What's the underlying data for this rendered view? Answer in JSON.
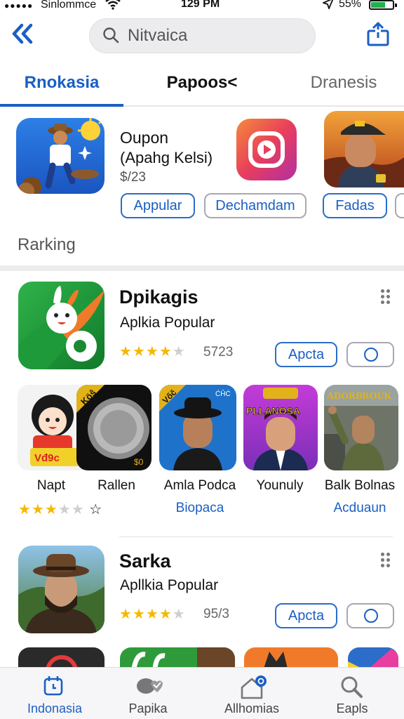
{
  "status_bar": {
    "signal": "●●●●●",
    "carrier": "Sinlommce",
    "time": "129 PM",
    "battery_pct": "55%",
    "battery_level": 0.55
  },
  "header": {
    "search_placeholder": "Nitvaica",
    "back_icon": "double-chevron-left-icon",
    "share_icon": "share-icon"
  },
  "tabs": [
    {
      "label": "Rnokasia",
      "active": true
    },
    {
      "label": "Papoos<",
      "active": false
    },
    {
      "label": "Dranesis",
      "active": false
    }
  ],
  "featured": {
    "title": "Oupon",
    "subtitle": "(Apahg Kelsi)",
    "price": "$/23",
    "buttons": [
      "Appular",
      "Dechamdam",
      "Fadas"
    ]
  },
  "section_label": "Rarking",
  "apps": [
    {
      "title": "Dpikagis",
      "subtitle": "Aplkia Popular",
      "rating": 4,
      "rating_count": "5723",
      "action": "Apcta"
    },
    {
      "title": "Sarka",
      "subtitle": "Apllkia Popular",
      "rating": 4,
      "rating_count": "95/3",
      "action": "Apcta"
    }
  ],
  "grid": [
    {
      "label": "Napt",
      "link": ""
    },
    {
      "label": "Rallen",
      "link": ""
    },
    {
      "label": "Amla Podca",
      "link": "Biopaca"
    },
    {
      "label": "Younuly",
      "link": ""
    },
    {
      "label": "Balk Bolnas",
      "link": "Acduaun"
    }
  ],
  "grid_rating": 3,
  "icon_texts": {
    "sticker": "Vđ9c",
    "badge1": "Köŝ",
    "coin": "$0",
    "hat": "Vốč",
    "hat2": "ĆĤĊ",
    "pllanosa": "PLLANOSA",
    "adorbrouk": "ADORBROUK"
  },
  "bottom_nav": [
    {
      "label": "Indonasia",
      "icon": "calendar-icon",
      "active": true
    },
    {
      "label": "Papika",
      "icon": "chat-heart-icon",
      "active": false
    },
    {
      "label": "Allhomias",
      "icon": "home-badge-icon",
      "active": false
    },
    {
      "label": "Eapls",
      "icon": "search-icon",
      "active": false
    }
  ],
  "colors": {
    "accent": "#1a5fc4",
    "star": "#f5b800"
  }
}
